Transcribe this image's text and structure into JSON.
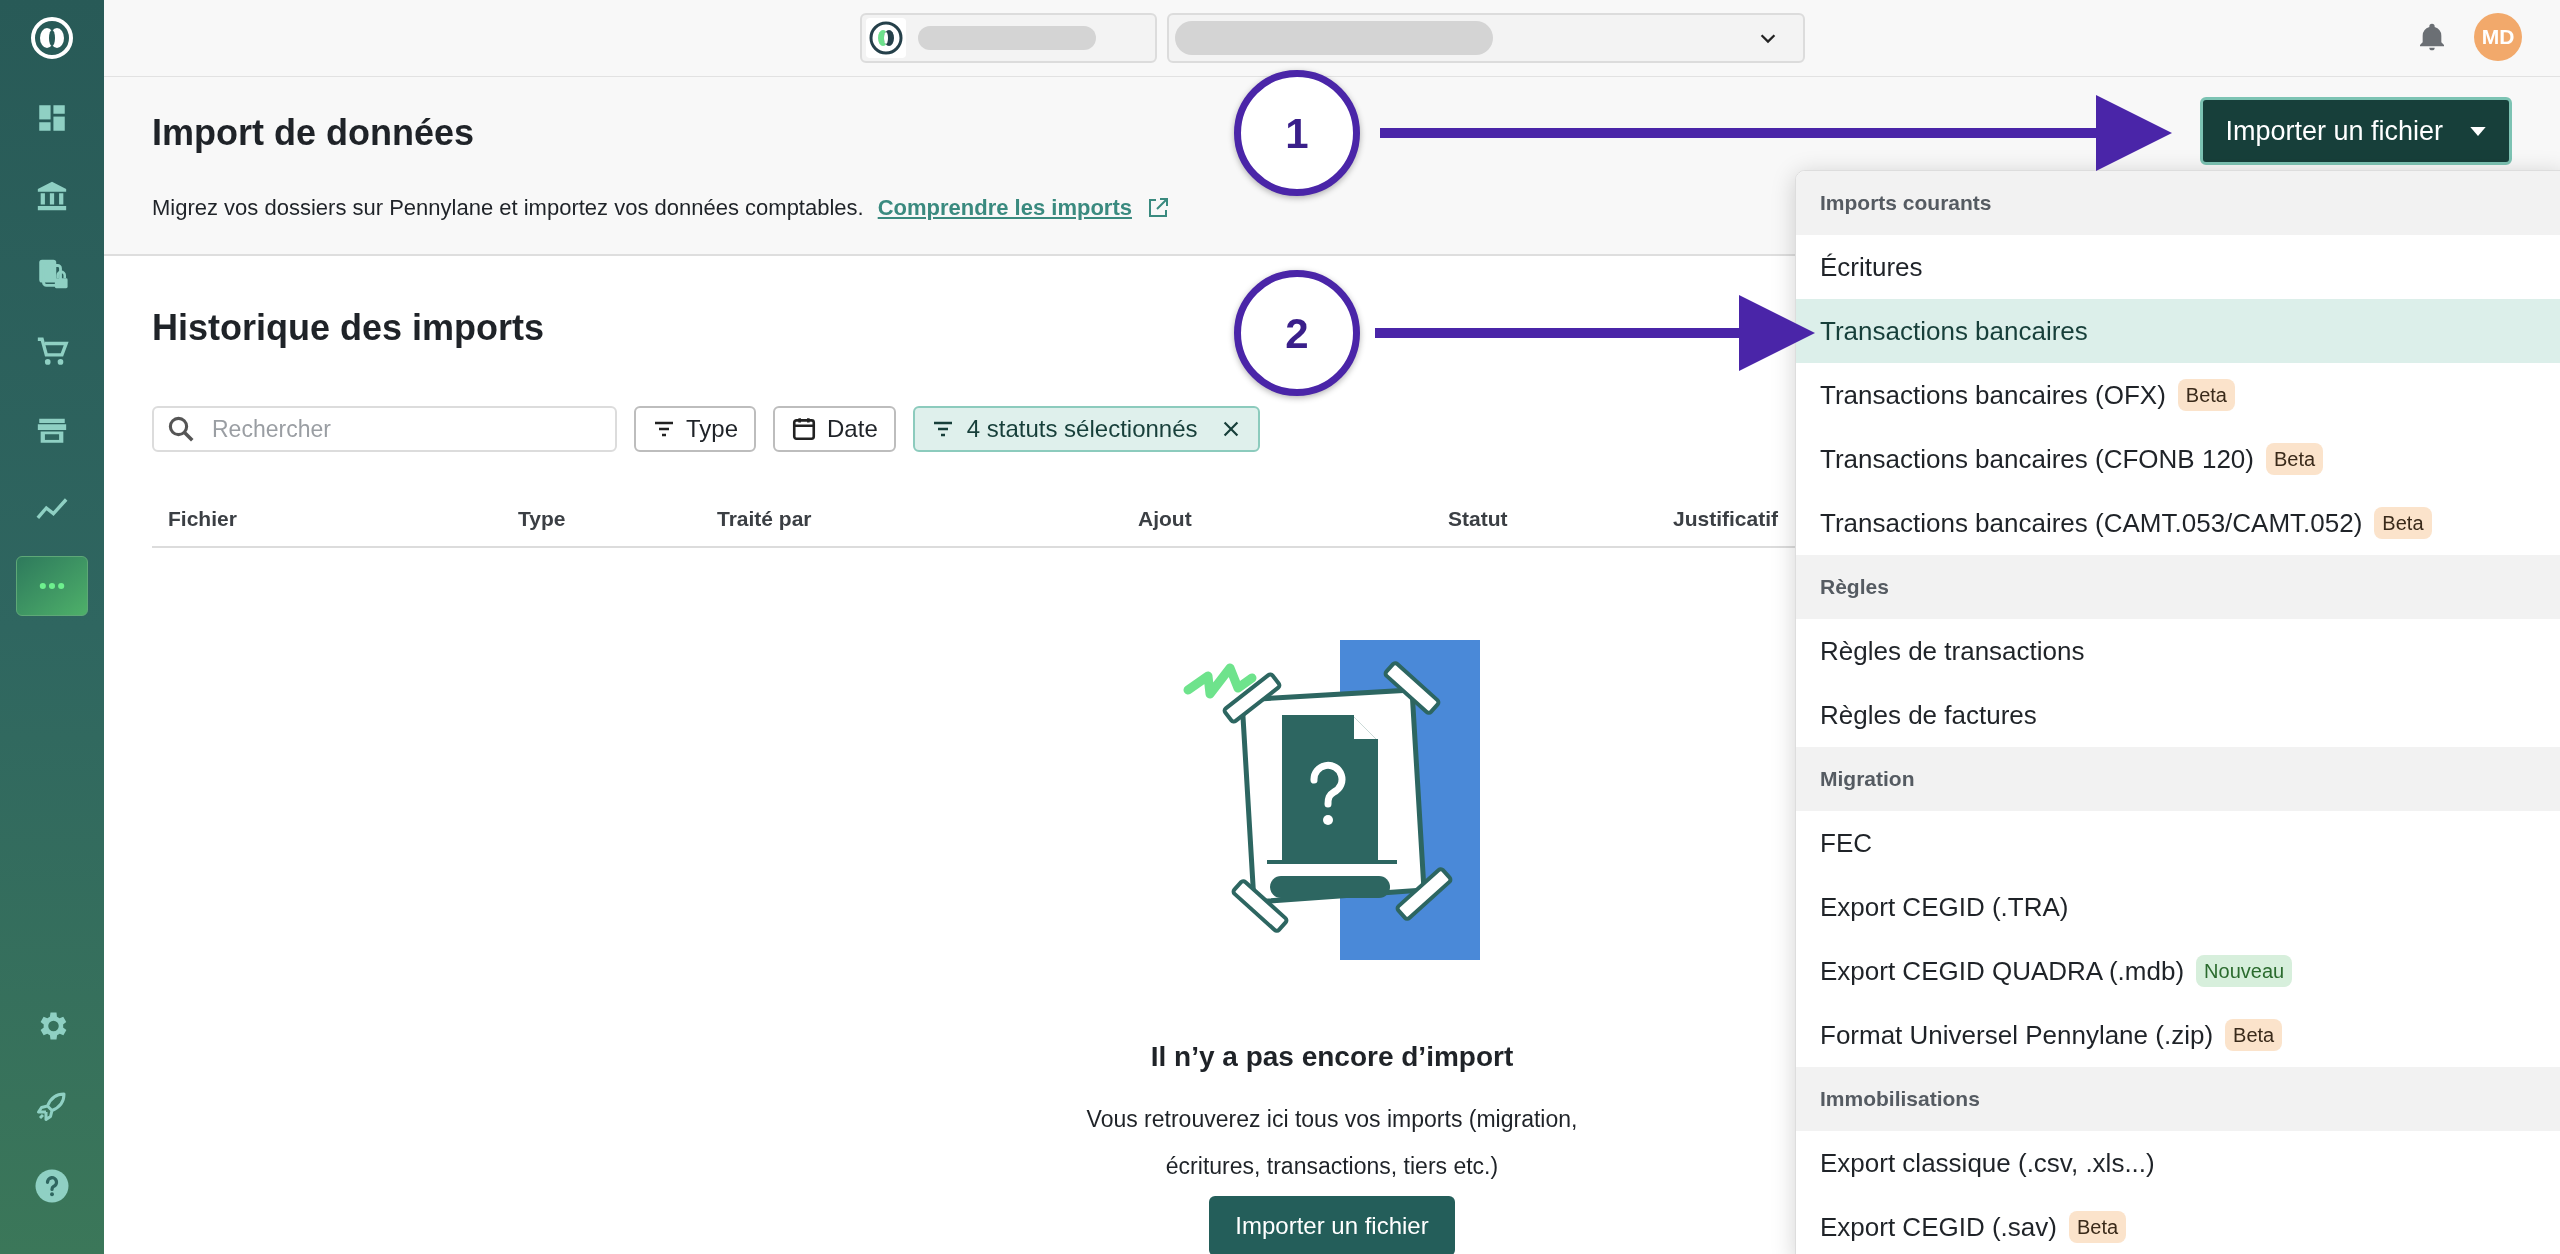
{
  "sidebar": {
    "items": [
      {
        "selected": false
      },
      {
        "selected": false
      },
      {
        "selected": false
      },
      {
        "selected": false
      },
      {
        "selected": false
      },
      {
        "selected": false
      },
      {
        "selected": true
      }
    ]
  },
  "topbar": {
    "avatar": "MD"
  },
  "header": {
    "title": "Import de données",
    "subtitle": "Migrez vos dossiers sur Pennylane et importez vos données comptables.",
    "link": "Comprendre les imports",
    "button": "Importer un fichier"
  },
  "history": {
    "title": "Historique des imports",
    "search": {
      "placeholder": "Rechercher"
    },
    "filters": [
      {
        "label": "Type",
        "kind": "filter"
      },
      {
        "label": "Date",
        "kind": "date"
      },
      {
        "label": "4 statuts sélectionnés",
        "kind": "active"
      }
    ],
    "columns": [
      "Fichier",
      "Type",
      "Traité par",
      "Ajout",
      "Statut",
      "Justificatif"
    ]
  },
  "empty_state": {
    "title": "Il n’y a pas encore d’import",
    "text": "Vous retrouverez ici tous vos imports (migration, écritures, transactions, tiers etc.)",
    "button": "Importer un fichier"
  },
  "menu": {
    "sections": [
      {
        "header": "Imports courants",
        "items": [
          {
            "label": "Écritures",
            "selected": false
          },
          {
            "label": "Transactions bancaires",
            "selected": true
          },
          {
            "label": "Transactions bancaires (OFX)",
            "selected": false,
            "badge": {
              "text": "Beta",
              "kind": "beta"
            }
          },
          {
            "label": "Transactions bancaires (CFONB 120)",
            "selected": false,
            "badge": {
              "text": "Beta",
              "kind": "beta"
            }
          },
          {
            "label": "Transactions bancaires (CAMT.053/CAMT.052)",
            "selected": false,
            "badge": {
              "text": "Beta",
              "kind": "beta"
            }
          }
        ]
      },
      {
        "header": "Règles",
        "items": [
          {
            "label": "Règles de transactions",
            "selected": false
          },
          {
            "label": "Règles de factures",
            "selected": false
          }
        ]
      },
      {
        "header": "Migration",
        "items": [
          {
            "label": "FEC",
            "selected": false
          },
          {
            "label": "Export CEGID (.TRA)",
            "selected": false
          },
          {
            "label": "Export CEGID QUADRA (.mdb)",
            "selected": false,
            "badge": {
              "text": "Nouveau",
              "kind": "new"
            }
          },
          {
            "label": "Format Universel Pennylane (.zip)",
            "selected": false,
            "badge": {
              "text": "Beta",
              "kind": "beta"
            }
          }
        ]
      },
      {
        "header": "Immobilisations",
        "items": [
          {
            "label": "Export classique (.csv, .xls...)",
            "selected": false
          },
          {
            "label": "Export CEGID (.sav)",
            "selected": false,
            "badge": {
              "text": "Beta",
              "kind": "beta"
            }
          }
        ]
      }
    ]
  },
  "callouts": [
    {
      "number": "1"
    },
    {
      "number": "2"
    }
  ]
}
